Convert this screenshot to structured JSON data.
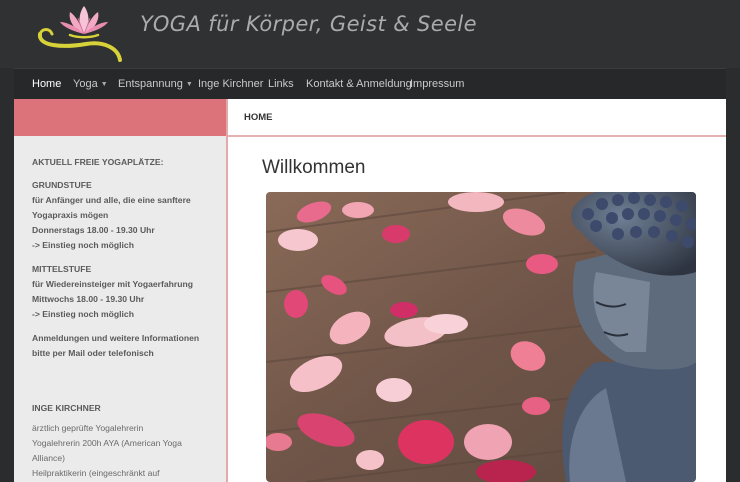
{
  "site": {
    "title": "YOGA für Körper, Geist & Seele"
  },
  "nav": {
    "items": [
      {
        "label": "Home",
        "active": true
      },
      {
        "label": "Yoga",
        "dropdown": true
      },
      {
        "label": "Entspannung",
        "dropdown": true
      },
      {
        "label": "Inge Kirchner"
      },
      {
        "label": "Links"
      },
      {
        "label": "Kontakt & Anmeldung"
      },
      {
        "label": "Impressum"
      }
    ]
  },
  "breadcrumb": {
    "label": "HOME"
  },
  "main": {
    "title": "Willkommen"
  },
  "sidebar": {
    "heading": "AKTUELL FREIE YOGAPLÄTZE:",
    "grund": {
      "title": "GRUNDSTUFE",
      "l1": "für Anfänger und alle, die eine sanftere",
      "l2": "Yogapraxis mögen",
      "l3": "Donnerstags 18.00 - 19.30 Uhr",
      "l4": "-> Einstieg noch möglich"
    },
    "mittel": {
      "title": "MITTELSTUFE",
      "l1": "für Wiedereinsteiger mit Yogaerfahrung",
      "l2": "Mittwochs 18.00 - 19.30 Uhr",
      "l3": "-> Einstieg noch möglich"
    },
    "anm": {
      "l1": "Anmeldungen und weitere Informationen",
      "l2": "bitte per Mail oder telefonisch"
    },
    "inge": {
      "title": "INGE KIRCHNER",
      "l1": "ärztlich geprüfte Yogalehrerin",
      "l2": "Yogalehrerin 200h AYA (American Yoga",
      "l3": "Alliance)",
      "l4": "Heilpraktikerin (eingeschränkt auf"
    }
  },
  "colors": {
    "accent": "#dc737a",
    "border": "#e2a9a9",
    "nav_bg": "#26282a"
  }
}
